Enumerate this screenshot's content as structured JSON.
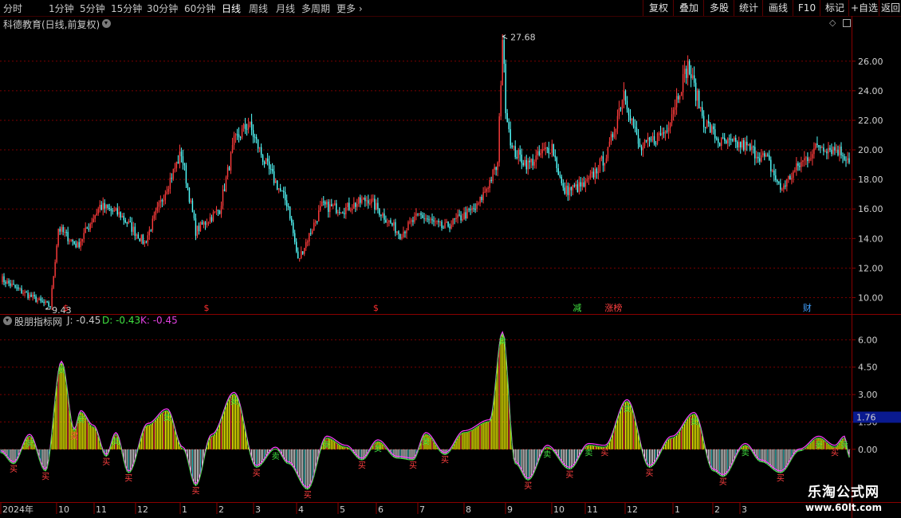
{
  "toolbar": {
    "timeframes": [
      "分时",
      "1分钟",
      "5分钟",
      "15分钟",
      "30分钟",
      "60分钟",
      "日线",
      "周线",
      "月线",
      "多周期",
      "更多"
    ],
    "active_timeframe": "日线",
    "right_buttons": [
      "复权",
      "叠加",
      "多股",
      "统计",
      "画线",
      "F10",
      "标记",
      "+自选",
      "返回"
    ]
  },
  "main_panel": {
    "title": "科德教育(日线,前复权)",
    "high_label": "27.68",
    "low_label": "9.43",
    "event_markers": [
      {
        "text": "$",
        "color": "#ff3030",
        "date_index": 39
      },
      {
        "text": "$",
        "color": "#ff3030",
        "date_index": 127
      },
      {
        "text": "$",
        "color": "#ff3030",
        "date_index": 233
      },
      {
        "text": "减",
        "color": "#40e040",
        "date_index": 358
      },
      {
        "text": "涨榜",
        "color": "#ff4040",
        "date_index": 378
      },
      {
        "text": "财",
        "color": "#40a0ff",
        "date_index": 502
      }
    ]
  },
  "indicator_panel": {
    "title": "股朋指标网",
    "j_label": "J: -0.45",
    "d_label": "D: -0.43",
    "k_label": "K: -0.45",
    "current_value_tag": "1.76",
    "buy_label": "买",
    "sell_label": "卖"
  },
  "date_axis": [
    "2024年",
    "10",
    "11",
    "12",
    "1",
    "2",
    "3",
    "4",
    "5",
    "6",
    "7",
    "8",
    "9",
    "10",
    "11",
    "12",
    "1",
    "2",
    "3"
  ],
  "watermark": {
    "title": "乐淘公式网",
    "url": "www.60lt.com"
  },
  "colors": {
    "up": "#ff3c3c",
    "down": "#54ffff",
    "bg": "#000000",
    "grid": "#7a0000",
    "yellow": "#ffff00",
    "white": "#ffffff"
  },
  "chart_data": {
    "type": "candlestick",
    "price_axis": {
      "ticks": [
        10,
        12,
        14,
        16,
        18,
        20,
        22,
        24,
        26
      ],
      "range": [
        9.0,
        28.2
      ]
    },
    "indicator_axis": {
      "ticks": [
        0.0,
        1.5,
        3.0,
        4.5,
        6.0
      ],
      "range": [
        -2.8,
        6.8
      ]
    },
    "anchors": [
      {
        "i": 0,
        "price": 11.3
      },
      {
        "i": 10,
        "price": 10.6
      },
      {
        "i": 25,
        "price": 9.7
      },
      {
        "i": 31,
        "price": 9.43
      },
      {
        "i": 36,
        "price": 14.7
      },
      {
        "i": 48,
        "price": 13.5
      },
      {
        "i": 62,
        "price": 16.2
      },
      {
        "i": 75,
        "price": 15.6
      },
      {
        "i": 90,
        "price": 13.7
      },
      {
        "i": 104,
        "price": 17.5
      },
      {
        "i": 113,
        "price": 19.8
      },
      {
        "i": 122,
        "price": 14.5
      },
      {
        "i": 137,
        "price": 16.0
      },
      {
        "i": 146,
        "price": 20.5
      },
      {
        "i": 155,
        "price": 21.8
      },
      {
        "i": 165,
        "price": 19.2
      },
      {
        "i": 180,
        "price": 16.2
      },
      {
        "i": 186,
        "price": 12.5
      },
      {
        "i": 201,
        "price": 16.2
      },
      {
        "i": 215,
        "price": 16.0
      },
      {
        "i": 230,
        "price": 16.7
      },
      {
        "i": 250,
        "price": 14.3
      },
      {
        "i": 262,
        "price": 15.6
      },
      {
        "i": 277,
        "price": 14.7
      },
      {
        "i": 298,
        "price": 16.1
      },
      {
        "i": 311,
        "price": 19.0
      },
      {
        "i": 314,
        "price": 27.68
      },
      {
        "i": 316,
        "price": 23.0
      },
      {
        "i": 320,
        "price": 20.0
      },
      {
        "i": 330,
        "price": 19.0
      },
      {
        "i": 345,
        "price": 20.3
      },
      {
        "i": 352,
        "price": 17.2
      },
      {
        "i": 366,
        "price": 17.6
      },
      {
        "i": 380,
        "price": 19.8
      },
      {
        "i": 390,
        "price": 24.0
      },
      {
        "i": 400,
        "price": 20.0
      },
      {
        "i": 416,
        "price": 21.3
      },
      {
        "i": 430,
        "price": 25.7
      },
      {
        "i": 440,
        "price": 22.0
      },
      {
        "i": 450,
        "price": 20.5
      },
      {
        "i": 465,
        "price": 20.3
      },
      {
        "i": 480,
        "price": 19.3
      },
      {
        "i": 488,
        "price": 17.3
      },
      {
        "i": 500,
        "price": 19.0
      },
      {
        "i": 512,
        "price": 20.3
      },
      {
        "i": 524,
        "price": 20.0
      },
      {
        "i": 531,
        "price": 19.4
      }
    ],
    "indicator_anchors": [
      {
        "i": 0,
        "v": -0.2
      },
      {
        "i": 8,
        "v": -0.8
      },
      {
        "i": 18,
        "v": 0.7
      },
      {
        "i": 28,
        "v": -1.2
      },
      {
        "i": 38,
        "v": 4.7
      },
      {
        "i": 46,
        "v": 1.0
      },
      {
        "i": 50,
        "v": 2.0
      },
      {
        "i": 58,
        "v": 1.2
      },
      {
        "i": 66,
        "v": -0.4
      },
      {
        "i": 72,
        "v": 0.8
      },
      {
        "i": 80,
        "v": -1.3
      },
      {
        "i": 92,
        "v": 1.3
      },
      {
        "i": 104,
        "v": 2.1
      },
      {
        "i": 114,
        "v": 0.0
      },
      {
        "i": 122,
        "v": -2.0
      },
      {
        "i": 132,
        "v": 0.7
      },
      {
        "i": 146,
        "v": 3.0
      },
      {
        "i": 160,
        "v": -1.0
      },
      {
        "i": 172,
        "v": 0.0
      },
      {
        "i": 180,
        "v": -0.8
      },
      {
        "i": 192,
        "v": -2.2
      },
      {
        "i": 204,
        "v": 0.6
      },
      {
        "i": 216,
        "v": 0.1
      },
      {
        "i": 226,
        "v": -0.6
      },
      {
        "i": 236,
        "v": 0.4
      },
      {
        "i": 248,
        "v": -0.5
      },
      {
        "i": 258,
        "v": -0.6
      },
      {
        "i": 266,
        "v": 0.8
      },
      {
        "i": 278,
        "v": -0.3
      },
      {
        "i": 290,
        "v": 0.9
      },
      {
        "i": 306,
        "v": 1.5
      },
      {
        "i": 314,
        "v": 6.3
      },
      {
        "i": 322,
        "v": -0.8
      },
      {
        "i": 330,
        "v": -1.7
      },
      {
        "i": 342,
        "v": 0.1
      },
      {
        "i": 356,
        "v": -1.1
      },
      {
        "i": 368,
        "v": 0.2
      },
      {
        "i": 378,
        "v": 0.1
      },
      {
        "i": 392,
        "v": 2.6
      },
      {
        "i": 406,
        "v": -1.0
      },
      {
        "i": 420,
        "v": 0.6
      },
      {
        "i": 434,
        "v": 1.9
      },
      {
        "i": 446,
        "v": -1.2
      },
      {
        "i": 452,
        "v": -1.5
      },
      {
        "i": 466,
        "v": 0.2
      },
      {
        "i": 476,
        "v": -0.7
      },
      {
        "i": 488,
        "v": -1.3
      },
      {
        "i": 500,
        "v": -0.1
      },
      {
        "i": 512,
        "v": 0.6
      },
      {
        "i": 522,
        "v": 0.1
      },
      {
        "i": 528,
        "v": 0.6
      },
      {
        "i": 531,
        "v": -0.45
      }
    ],
    "bar_count": 532
  }
}
